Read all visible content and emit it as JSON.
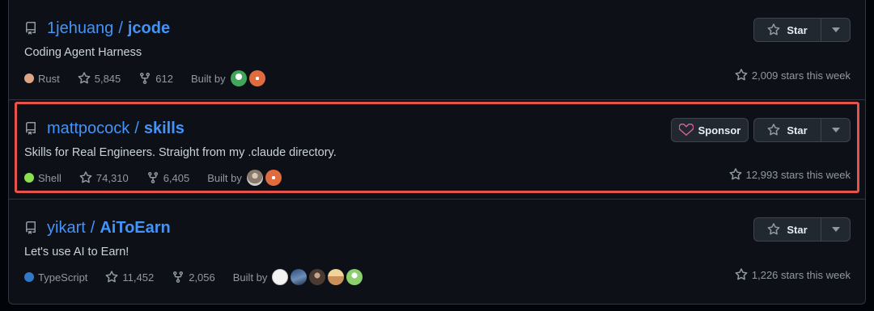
{
  "repos": [
    {
      "owner": "1jehuang",
      "name": "jcode",
      "description": "Coding Agent Harness",
      "language": "Rust",
      "language_color": "#dea584",
      "stars": "5,845",
      "forks": "612",
      "built_by_label": "Built by",
      "contributors": [
        "avatar-green",
        "avatar-orange-burst"
      ],
      "weekly_stars": "2,009 stars this week",
      "star_label": "Star"
    },
    {
      "owner": "mattpocock",
      "name": "skills",
      "description": "Skills for Real Engineers. Straight from my .claude directory.",
      "language": "Shell",
      "language_color": "#89e051",
      "stars": "74,310",
      "forks": "6,405",
      "built_by_label": "Built by",
      "contributors": [
        "avatar-person",
        "avatar-orange-burst"
      ],
      "weekly_stars": "12,993 stars this week",
      "star_label": "Star",
      "sponsor_label": "Sponsor",
      "highlighted": true
    },
    {
      "owner": "yikart",
      "name": "AiToEarn",
      "description": "Let's use AI to Earn!",
      "language": "TypeScript",
      "language_color": "#3178c6",
      "stars": "11,452",
      "forks": "2,056",
      "built_by_label": "Built by",
      "contributors": [
        "avatar-white",
        "avatar-blue-scene",
        "avatar-person-dark",
        "avatar-tan",
        "avatar-green-light"
      ],
      "weekly_stars": "1,226 stars this week",
      "star_label": "Star"
    }
  ],
  "colors": {
    "link": "#4493f8",
    "highlight_border": "#e5534b",
    "sponsor_heart": "#db61a2"
  }
}
